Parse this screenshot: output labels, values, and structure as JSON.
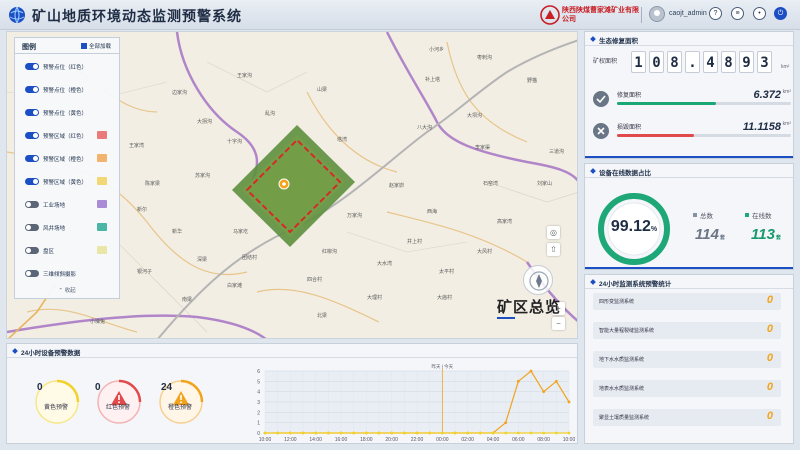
{
  "header": {
    "title": "矿山地质环境动态监测预警系统",
    "company_name": "陕西陕煤曹家滩矿业有限公司",
    "username": "caojt_admin"
  },
  "map": {
    "overview_title": "矿区总览",
    "labels": [
      "小河乡",
      "枣刺沟",
      "王家沟",
      "山梁",
      "补上塔",
      "野猫",
      "边家沟",
      "乱沟",
      "大拐沟",
      "十字沟",
      "八大沟",
      "大坝沟",
      "三道沟",
      "塔湾",
      "王家湾",
      "李家渠",
      "苏家沟",
      "陈家梁",
      "赵家峁",
      "石窑湾",
      "刘家山",
      "新尔",
      "西海",
      "新华",
      "万家沟",
      "高家湾",
      "马家圪",
      "井上村",
      "红柳沟",
      "大风村",
      "深梁",
      "团结村",
      "大水湾",
      "银河子",
      "四合村",
      "太平村",
      "白家滩",
      "南梁",
      "大理村",
      "大庙村",
      "北梁",
      "小壕兔"
    ]
  },
  "legend": {
    "title": "图例",
    "select_all": "全部加载",
    "items": [
      {
        "label": "预警点位（红色）",
        "on": true,
        "color": ""
      },
      {
        "label": "预警点位（橙色）",
        "on": true,
        "color": ""
      },
      {
        "label": "预警点位（黄色）",
        "on": true,
        "color": ""
      },
      {
        "label": "预警区域（红色）",
        "on": true,
        "color": "#e97b78"
      },
      {
        "label": "预警区域（橙色）",
        "on": true,
        "color": "#f1b36d"
      },
      {
        "label": "预警区域（黄色）",
        "on": true,
        "color": "#f2d774"
      },
      {
        "label": "工业场地",
        "on": false,
        "color": "#a98bd6"
      },
      {
        "label": "风井场地",
        "on": false,
        "color": "#49b6a7"
      },
      {
        "label": "盘区",
        "on": false,
        "color": "#e9e6a8"
      },
      {
        "label": "三维倾斜摄影",
        "on": false,
        "color": ""
      }
    ],
    "collapse": "收起"
  },
  "eco_panel": {
    "title": "生态修复面积",
    "area_label": "矿权面积",
    "digits": [
      "1",
      "0",
      "8",
      ".",
      "4",
      "8",
      "9",
      "3"
    ],
    "area_unit": "km²",
    "restored": {
      "label": "修复面积",
      "value": "6.372",
      "unit": "km²",
      "progress": 0.57,
      "color": "#19a874"
    },
    "damaged": {
      "label": "损毁面积",
      "value": "11.1158",
      "unit": "km²",
      "progress": 0.44,
      "color": "#e14a4a"
    }
  },
  "online_panel": {
    "title": "设备在线数据占比",
    "percent_value": "99.12",
    "percent_sign": "%",
    "percent": 0.9912,
    "total_label": "总数",
    "total": "114",
    "online_label": "在线数",
    "online": "113",
    "unit": "套"
  },
  "alarm_stats": {
    "title": "24小时监测系统预警统计",
    "items": [
      {
        "name": "四形变监测系统",
        "count": "0"
      },
      {
        "name": "智能大量程裂缝监测系统",
        "count": "0"
      },
      {
        "name": "地下水水质监测系统",
        "count": "0"
      },
      {
        "name": "地表水水质监测系统",
        "count": "0"
      },
      {
        "name": "聚显土壤质量监测系统",
        "count": "0"
      }
    ]
  },
  "device_warnings": {
    "title": "24小时设备预警数据",
    "yellow": {
      "count": "0",
      "label": "黄色预警",
      "color": "#f2d12c"
    },
    "red": {
      "count": "0",
      "label": "红色预警",
      "color": "#e14a4a"
    },
    "orange": {
      "count": "24",
      "label": "橙色预警",
      "color": "#f2a31b"
    }
  },
  "chart_data": {
    "type": "line",
    "x": [
      "10:00",
      "11:00",
      "12:00",
      "13:00",
      "14:00",
      "15:00",
      "16:00",
      "17:00",
      "18:00",
      "19:00",
      "20:00",
      "21:00",
      "22:00",
      "23:00",
      "00:00",
      "01:00",
      "02:00",
      "03:00",
      "04:00",
      "05:00",
      "06:00",
      "07:00",
      "08:00",
      "09:00",
      "10:00"
    ],
    "x_tick_labels": [
      "10:00",
      "12:00",
      "14:00",
      "16:00",
      "18:00",
      "20:00",
      "22:00",
      "00:00",
      "02:00",
      "04:00",
      "06:00",
      "08:00",
      "10:00"
    ],
    "ylim": [
      0,
      6
    ],
    "y_ticks": [
      0,
      1,
      2,
      3,
      4,
      5,
      6
    ],
    "marker_text": "昨天 | 今天",
    "marker_x": "00:00",
    "series": [
      {
        "color": "#f2a31b",
        "values": [
          0,
          0,
          0,
          0,
          0,
          0,
          0,
          0,
          0,
          0,
          0,
          0,
          0,
          0,
          0,
          0,
          0,
          0,
          0,
          1,
          5,
          6,
          4,
          5,
          3
        ]
      },
      {
        "color": "#f2d12c",
        "values": [
          0,
          0,
          0,
          0,
          0,
          0,
          0,
          0,
          0,
          0,
          0,
          0,
          0,
          0,
          0,
          0,
          0,
          0,
          0,
          0,
          0,
          0,
          0,
          0,
          0
        ]
      }
    ]
  }
}
